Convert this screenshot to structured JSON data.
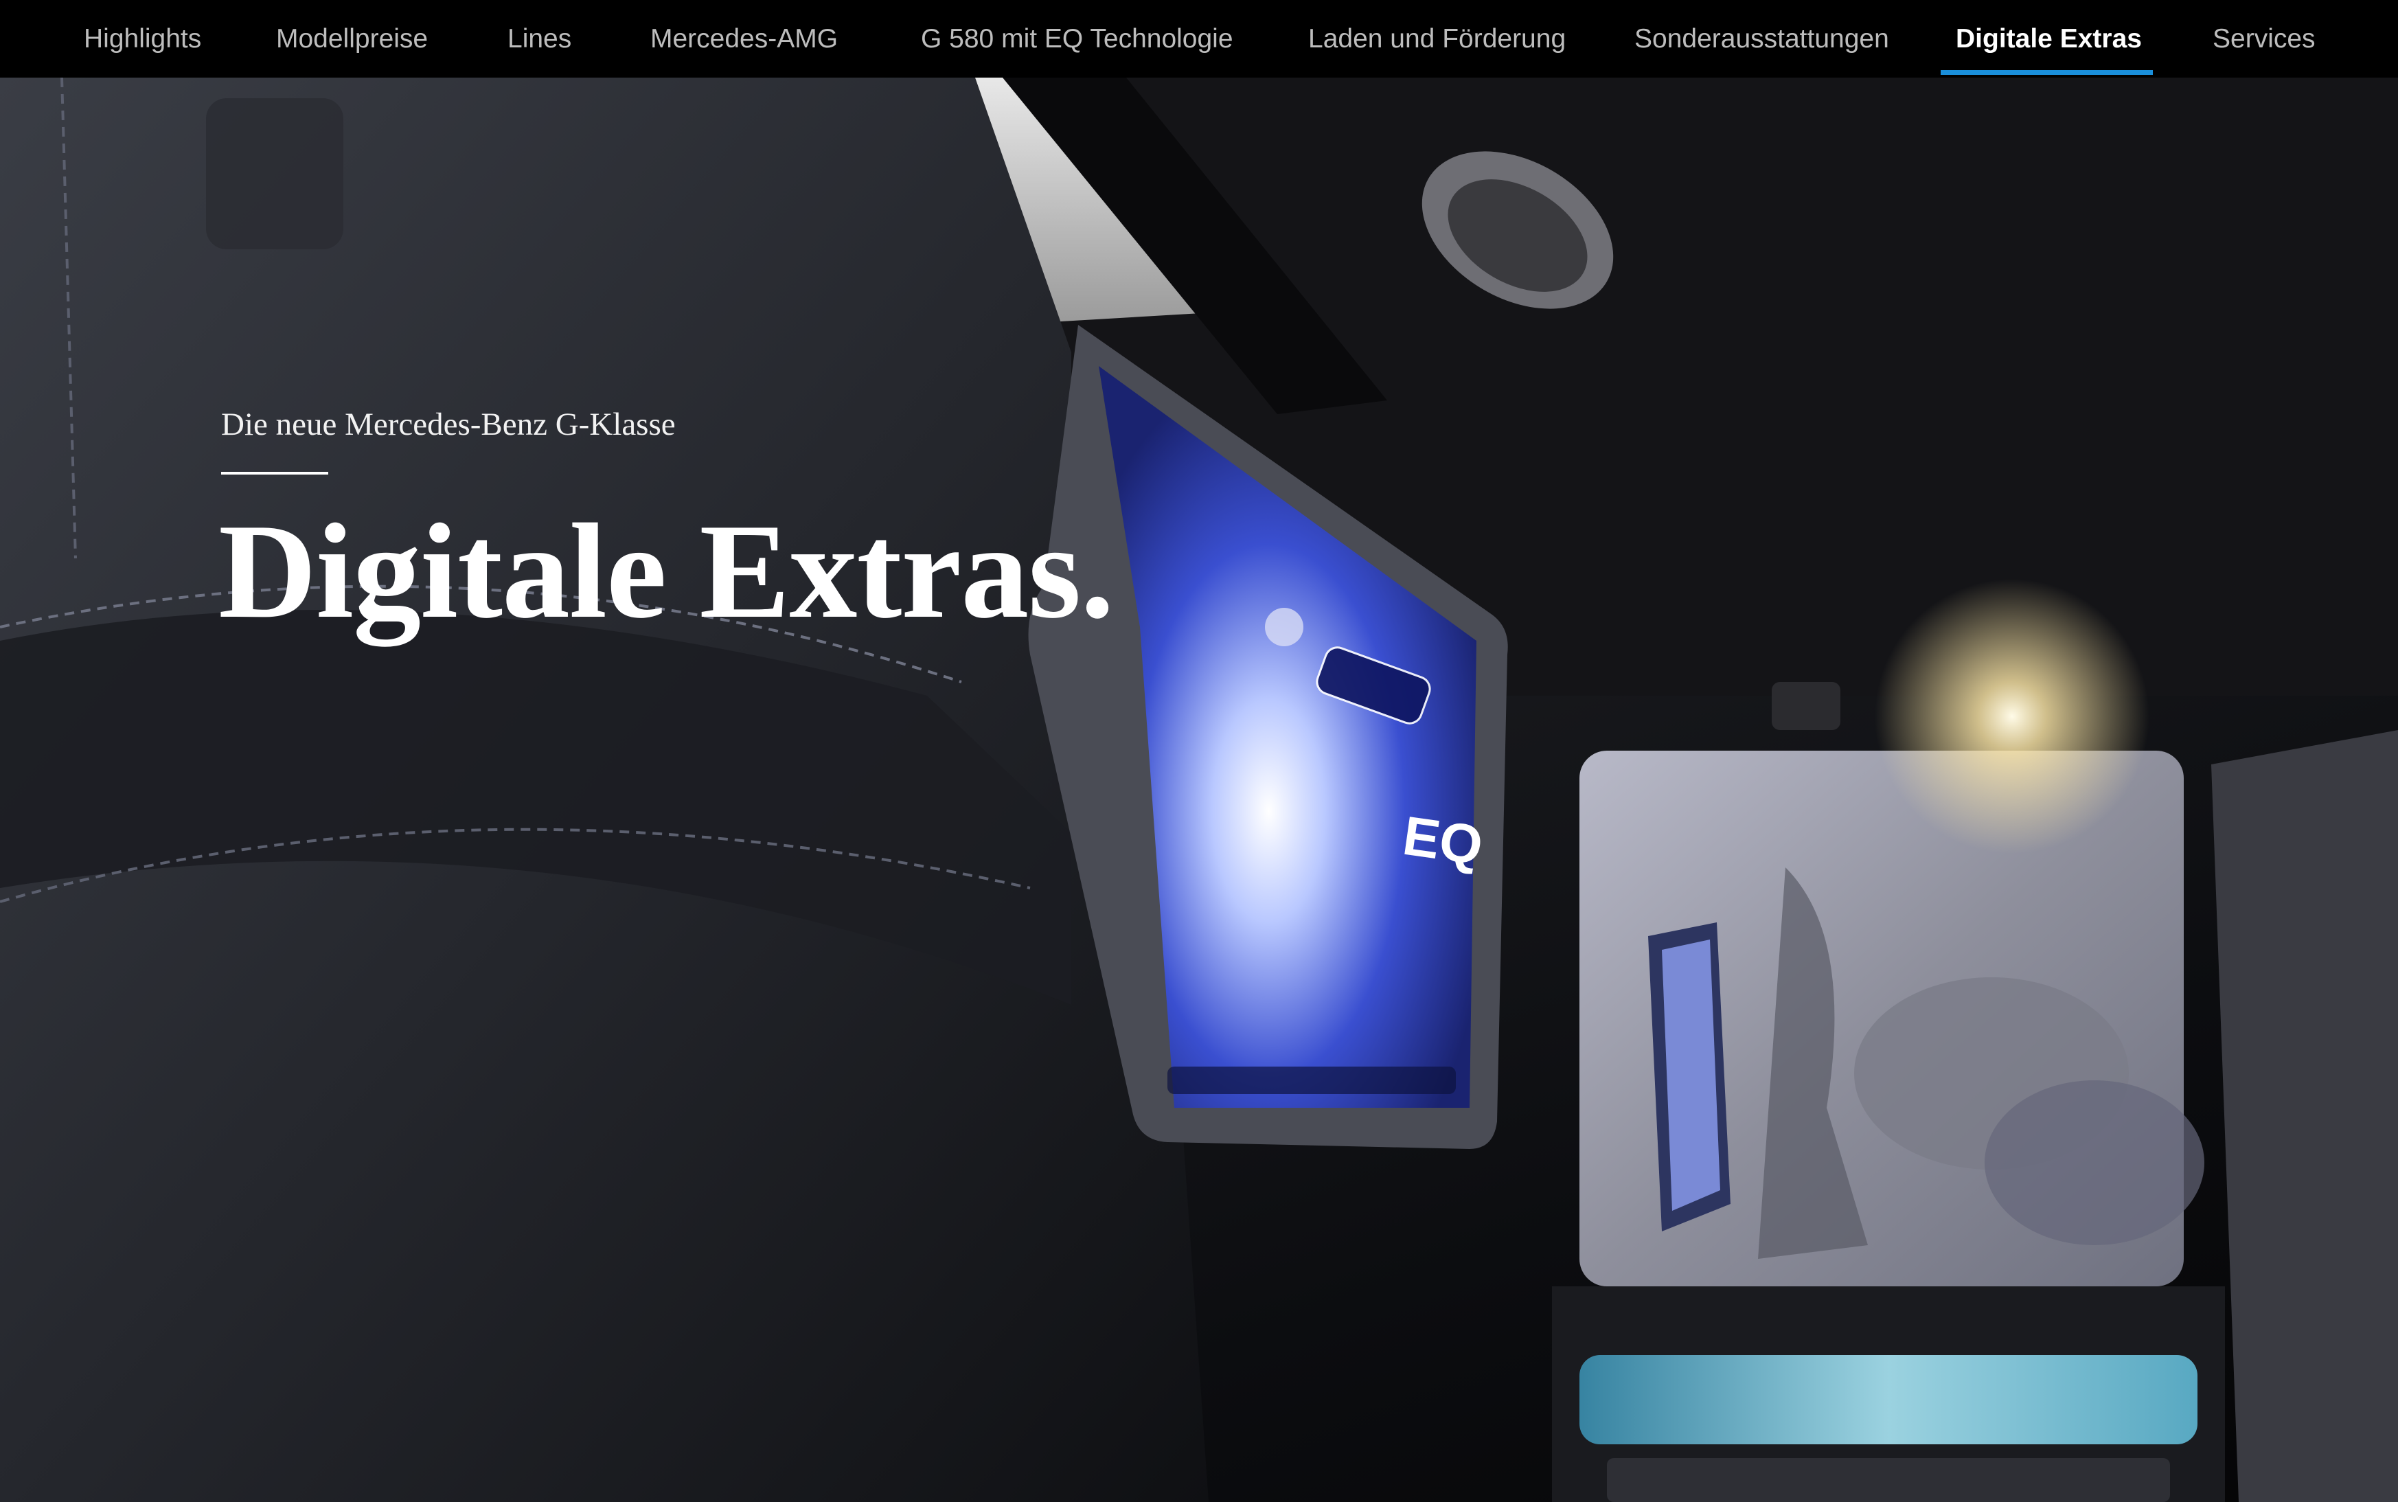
{
  "nav": {
    "items": [
      {
        "label": "Highlights"
      },
      {
        "label": "Modellpreise"
      },
      {
        "label": "Lines"
      },
      {
        "label": "Mercedes-AMG"
      },
      {
        "label": "G 580 mit EQ Technologie"
      },
      {
        "label": "Laden und Förderung"
      },
      {
        "label": "Sonderausstattungen"
      },
      {
        "label": "Digitale Extras"
      },
      {
        "label": "Services"
      }
    ],
    "active_index": 7,
    "active_color": "#1a8fdb"
  },
  "hero": {
    "eyebrow": "Die neue Mercedes-Benz G-Klasse",
    "headline": "Digitale Extras.",
    "screen_badge": "EQ"
  }
}
